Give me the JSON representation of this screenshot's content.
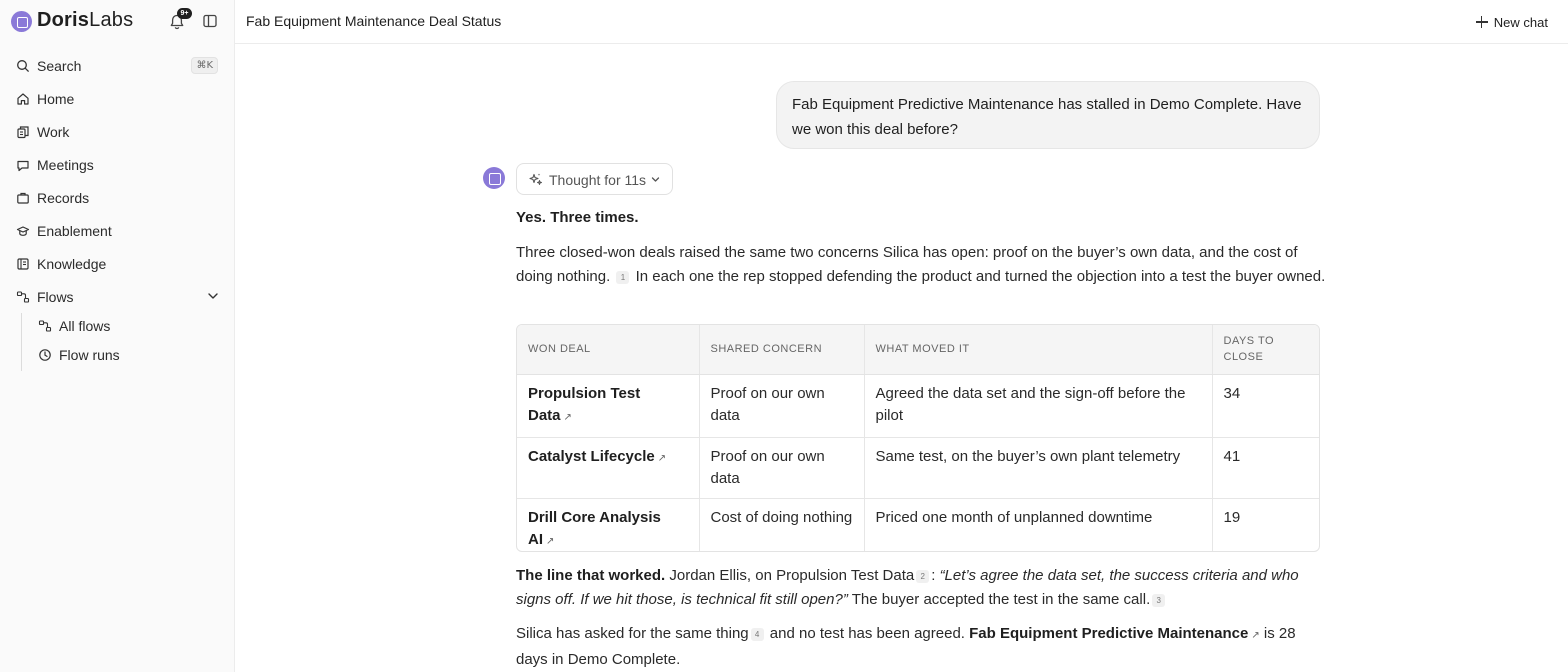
{
  "app": {
    "brand_bold": "Doris",
    "brand_light": "Labs",
    "notifications_badge": "9+"
  },
  "sidebar": {
    "items": [
      {
        "label": "Search",
        "shortcut": "⌘K",
        "icon": "search-icon"
      },
      {
        "label": "Home",
        "icon": "home-icon"
      },
      {
        "label": "Work",
        "icon": "work-icon"
      },
      {
        "label": "Meetings",
        "icon": "meetings-icon"
      },
      {
        "label": "Records",
        "icon": "records-icon"
      },
      {
        "label": "Enablement",
        "icon": "enablement-icon"
      },
      {
        "label": "Knowledge",
        "icon": "knowledge-icon"
      },
      {
        "label": "Flows",
        "icon": "flows-icon",
        "expanded": true
      }
    ],
    "sub_items": [
      {
        "label": "All flows",
        "icon": "flows-icon"
      },
      {
        "label": "Flow runs",
        "icon": "clock-icon"
      }
    ]
  },
  "header": {
    "title": "Fab Equipment Maintenance Deal Status",
    "new_chat_label": "New chat"
  },
  "chat": {
    "user_message": "Fab Equipment Predictive Maintenance has stalled in Demo Complete. Have we won this deal before?",
    "thought_label": "Thought for 11s",
    "answer_heading": "Yes. Three times.",
    "para1_a": "Three closed-won deals raised the same two concerns Silica has open: proof on the buyer’s own data, and the cost of doing nothing.",
    "para1_cite": "1",
    "para1_b": "In each one the rep stopped defending the product and turned the objection into a test the buyer owned.",
    "table": {
      "headers": [
        "WON DEAL",
        "SHARED CONCERN",
        "WHAT MOVED IT",
        "DAYS TO CLOSE"
      ],
      "rows": [
        {
          "deal": "Propulsion Test Data",
          "concern": "Proof on our own data",
          "moved": "Agreed the data set and the sign-off before the pilot",
          "days": "34"
        },
        {
          "deal": "Catalyst Lifecycle",
          "concern": "Proof on our own data",
          "moved": "Same test, on the buyer’s own plant telemetry",
          "days": "41"
        },
        {
          "deal": "Drill Core Analysis AI",
          "concern": "Cost of doing nothing",
          "moved": "Priced one month of unplanned downtime",
          "days": "19"
        }
      ]
    },
    "para2_bold": "The line that worked.",
    "para2_a": "Jordan Ellis, on Propulsion Test Data",
    "para2_cite1": "2",
    "para2_colon": ":",
    "para2_quote": "“Let’s agree the data set, the success criteria and who signs off. If we hit those, is technical fit still open?”",
    "para2_b": "The buyer accepted the test in the same call.",
    "para2_cite2": "3",
    "para3_a": "Silica has asked for the same thing",
    "para3_cite": "4",
    "para3_b": "and no test has been agreed.",
    "para3_link": "Fab Equipment Predictive Maintenance",
    "para3_c": "is 28 days in Demo Complete."
  },
  "colors": {
    "brand": "#8a79d8",
    "sidebar_bg": "#fafafa",
    "bubble_bg": "#f3f3f3"
  }
}
